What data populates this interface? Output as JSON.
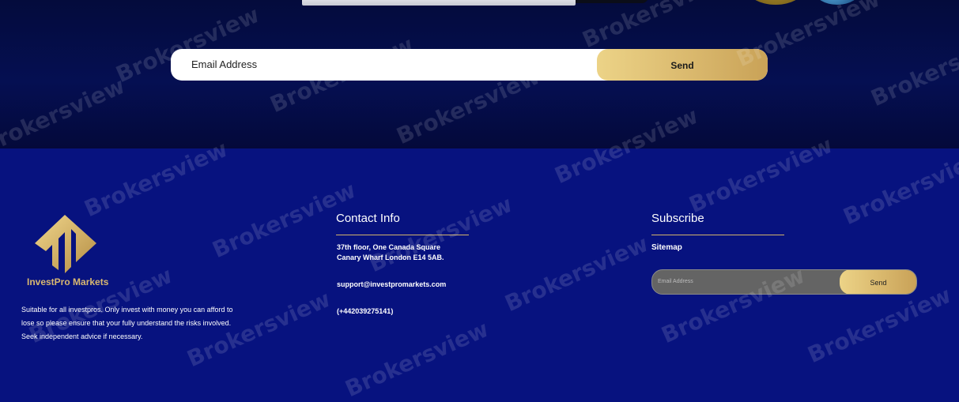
{
  "hero": {
    "email_placeholder": "Email Address",
    "send_label": "Send"
  },
  "brand": {
    "name": "InvestPro Markets",
    "description": "Suitable for all investpros. Only invest with money you can afford to lose so please ensure that your fully understand the risks involved. Seek independent advice if necessary."
  },
  "contact": {
    "title": "Contact Info",
    "address_line1": "37th floor, One Canada Square",
    "address_line2": "Canary Wharf London E14 5AB.",
    "email": "support@investpromarkets.com",
    "phone": "(+442039275141)"
  },
  "subscribe": {
    "title": "Subscribe",
    "sitemap_label": "Sitemap",
    "email_placeholder": "Email Address",
    "send_label": "Send"
  },
  "watermark": {
    "text": "Brokersview"
  },
  "colors": {
    "footer_bg": "#07127f",
    "hero_bg": "#050f52",
    "accent_gold": "#d8b66b"
  }
}
